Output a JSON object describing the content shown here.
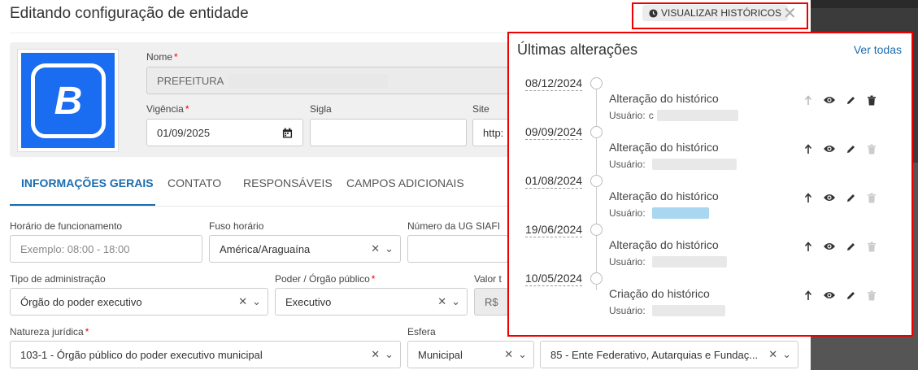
{
  "modal": {
    "title": "Editando configuração de entidade",
    "historico_button": "VISUALIZAR HISTÓRICOS"
  },
  "entity": {
    "logo_letter": "B",
    "nome_label": "Nome",
    "nome_value": "PREFEITURA",
    "vigencia_label": "Vigência",
    "vigencia_value": "01/09/2025",
    "sigla_label": "Sigla",
    "site_label": "Site",
    "site_value": "http:"
  },
  "tabs": [
    "INFORMAÇÕES GERAIS",
    "CONTATO",
    "RESPONSÁVEIS",
    "CAMPOS ADICIONAIS"
  ],
  "form": {
    "horario_label": "Horário de funcionamento",
    "horario_placeholder": "Exemplo: 08:00 - 18:00",
    "fuso_label": "Fuso horário",
    "fuso_value": "América/Araguaína",
    "ug_label": "Número da UG SIAFI",
    "tipo_adm_label": "Tipo de administração",
    "tipo_adm_value": "Órgão do poder executivo",
    "poder_label": "Poder / Órgão público",
    "poder_value": "Executivo",
    "valor_label": "Valor t",
    "valor_prefix": "R$",
    "natureza_label": "Natureza jurídica",
    "natureza_value": "103-1 - Órgão público do poder executivo municipal",
    "esfera_label": "Esfera",
    "esfera_value": "Municipal",
    "ente_value": "85 - Ente Federativo, Autarquias e Fundaç..."
  },
  "history": {
    "title": "Últimas alterações",
    "ver_todas": "Ver todas",
    "user_label": "Usuário:",
    "items": [
      {
        "date": "08/12/2024",
        "title": "Alteração do histórico",
        "user_partial": "c"
      },
      {
        "date": "09/09/2024",
        "title": "Alteração do histórico",
        "user_partial": ""
      },
      {
        "date": "01/08/2024",
        "title": "Alteração do histórico",
        "user_partial": ""
      },
      {
        "date": "19/06/2024",
        "title": "Alteração do histórico",
        "user_partial": ""
      },
      {
        "date": "10/05/2024",
        "title": "Criação do histórico",
        "user_partial": ""
      }
    ]
  },
  "colors": {
    "accent": "#1a6cb0",
    "logo_bg": "#1a6cf0",
    "highlight": "#e00000"
  }
}
